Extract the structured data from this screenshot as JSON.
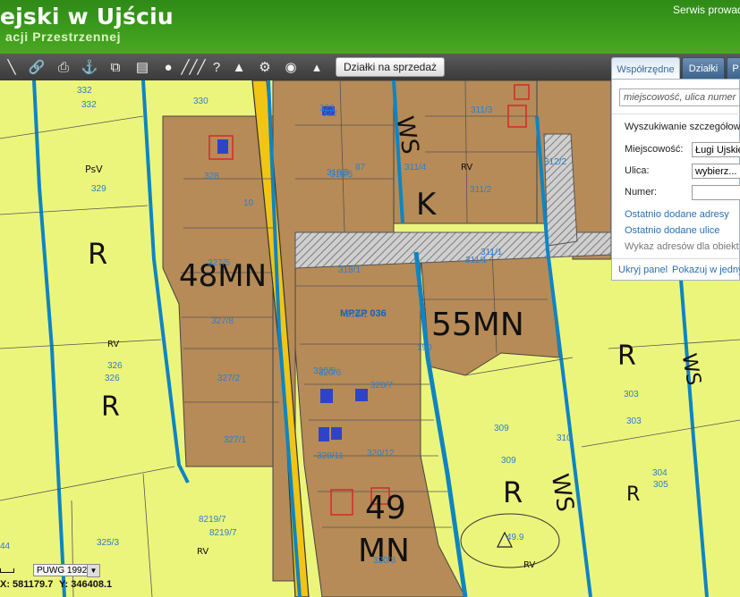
{
  "header": {
    "title": "ejski w Ujściu",
    "subtitle": "acji Przestrzennej",
    "service": "Serwis prowad"
  },
  "toolbar": {
    "sale_button": "Działki na sprzedaż",
    "tools": [
      "measure-line",
      "measure-chain",
      "print",
      "anchor",
      "copy",
      "layout",
      "comment",
      "hatch",
      "help",
      "triangle",
      "settings",
      "pin",
      "mountain"
    ]
  },
  "tabs": [
    "Współrzędne",
    "Działki",
    "P"
  ],
  "panel": {
    "search_placeholder": "miejscowość, ulica numer",
    "detailed_title": "Wyszukiwanie szczegółow",
    "city_label": "Miejscowość:",
    "city_value": "Ługi Ujskie",
    "street_label": "Ulica:",
    "street_value": "wybierz...",
    "number_label": "Numer:",
    "number_value": "",
    "recent_addresses": "Ostatnio dodane adresy",
    "recent_streets": "Ostatnio dodane ulice",
    "list_info": "Wykaz adresów dla obiekt",
    "hide_panel": "Ukryj panel",
    "show_single": "Pokazuj w jedny"
  },
  "map": {
    "zones": [
      "R",
      "R",
      "R",
      "R",
      "R",
      "PsV",
      "RV",
      "RV",
      "RV",
      "RV"
    ],
    "zone_codes": [
      "48MN",
      "55MN",
      "49",
      "MN",
      "WS",
      "WS",
      "WS",
      "K"
    ],
    "plan_label": "MPZP 036",
    "parcels": [
      "332",
      "330",
      "329",
      "328",
      "327/5",
      "327/8",
      "327/2",
      "327/1",
      "326",
      "326",
      "325/3",
      "332",
      "322",
      "323",
      "318/5",
      "318/5",
      "311/4",
      "311/3",
      "311/2",
      "311/1",
      "318/1",
      "311/1",
      "319/1",
      "320/5",
      "320/7",
      "320/11",
      "320/12",
      "320/8",
      "310",
      "309",
      "309",
      "303",
      "303",
      "304",
      "305",
      "8219/7",
      "8219/7",
      "44",
      "190",
      "87",
      "10",
      "312/2",
      "320/6",
      "49.9"
    ],
    "colors": {
      "agri": "#ecf57b",
      "build": "#b68b57",
      "road": "#f2c414",
      "water": "#0e85c2"
    }
  },
  "status": {
    "crs": "PUWG 1992",
    "x_label": "X: 581179.7",
    "y_label": "Y: 346408.1"
  }
}
